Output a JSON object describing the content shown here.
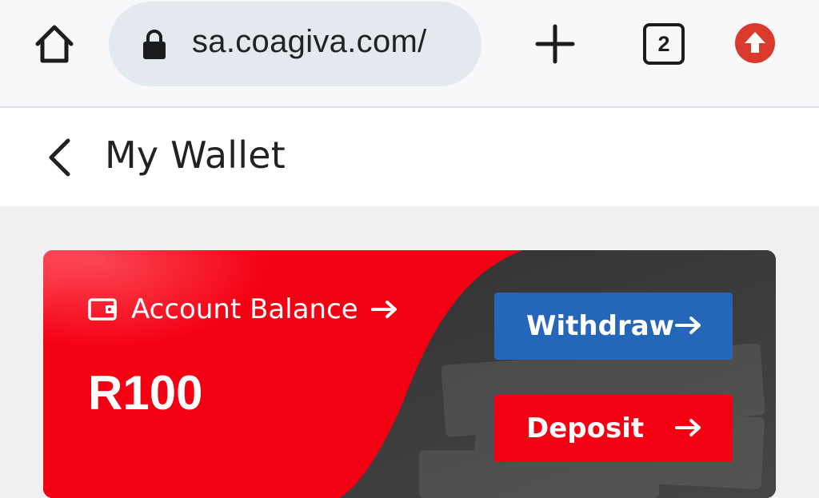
{
  "browser": {
    "url": "sa.coagiva.com/",
    "tab_count": "2"
  },
  "header": {
    "title": "My Wallet"
  },
  "wallet": {
    "balance_label": "Account Balance",
    "balance": "R100",
    "withdraw_label": "Withdraw",
    "deposit_label": "Deposit"
  },
  "icons": {
    "home": "home-icon",
    "lock": "lock-icon",
    "new_tab": "plus-icon",
    "tabs": "tabs-counter-icon",
    "update": "upload-arrow-icon",
    "back": "chevron-left-icon",
    "wallet": "wallet-icon",
    "arrow": "arrow-right-icon"
  },
  "colors": {
    "card_red": "#f40013",
    "withdraw_blue": "#2466b8",
    "update_badge": "#d93a2b"
  }
}
